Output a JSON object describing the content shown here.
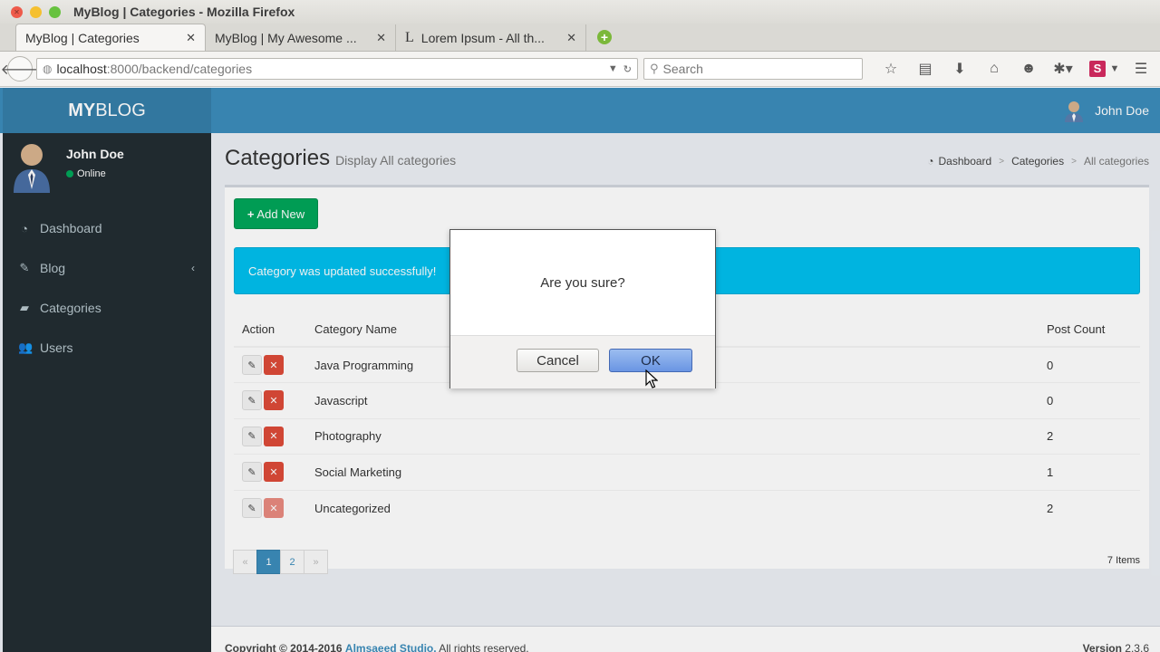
{
  "window": {
    "title": "MyBlog | Categories - Mozilla Firefox"
  },
  "tabs": [
    {
      "label": "MyBlog | Categories"
    },
    {
      "label": "MyBlog | My Awesome ..."
    },
    {
      "label": "Lorem Ipsum - All th..."
    }
  ],
  "urlbar": {
    "host": "localhost",
    "path": ":8000/backend/categories"
  },
  "searchbar": {
    "placeholder": "Search"
  },
  "header": {
    "logo_bold": "MY",
    "logo_rest": "BLOG",
    "user_name": "John Doe"
  },
  "sidebar": {
    "user_name": "John Doe",
    "status": "Online",
    "items": [
      {
        "label": "Dashboard"
      },
      {
        "label": "Blog"
      },
      {
        "label": "Categories"
      },
      {
        "label": "Users"
      }
    ]
  },
  "page": {
    "title": "Categories",
    "subtitle": "Display All categories",
    "breadcrumb": [
      "Dashboard",
      "Categories",
      "All categories"
    ]
  },
  "box": {
    "add_button": "Add New",
    "alert": "Category was updated successfully!",
    "columns": [
      "Action",
      "Category Name",
      "Post Count"
    ],
    "rows": [
      {
        "name": "Java Programming",
        "count": "0"
      },
      {
        "name": "Javascript",
        "count": "0"
      },
      {
        "name": "Photography",
        "count": "2"
      },
      {
        "name": "Social Marketing",
        "count": "1"
      },
      {
        "name": "Uncategorized",
        "count": "2"
      }
    ],
    "pagination": [
      "«",
      "1",
      "2",
      "»"
    ],
    "items_count": "7 Items"
  },
  "footer": {
    "copyright": "Copyright © 2014-2016",
    "studio": "Almsaeed Studio.",
    "rights": "All rights reserved.",
    "version_label": "Version",
    "version": "2.3.6"
  },
  "dialog": {
    "message": "Are you sure?",
    "cancel": "Cancel",
    "ok": "OK"
  },
  "colors": {
    "header": "#3c8dbc",
    "sidebar": "#222d32",
    "success": "#00a65a",
    "info": "#00c0ef",
    "danger": "#dd4b39"
  }
}
